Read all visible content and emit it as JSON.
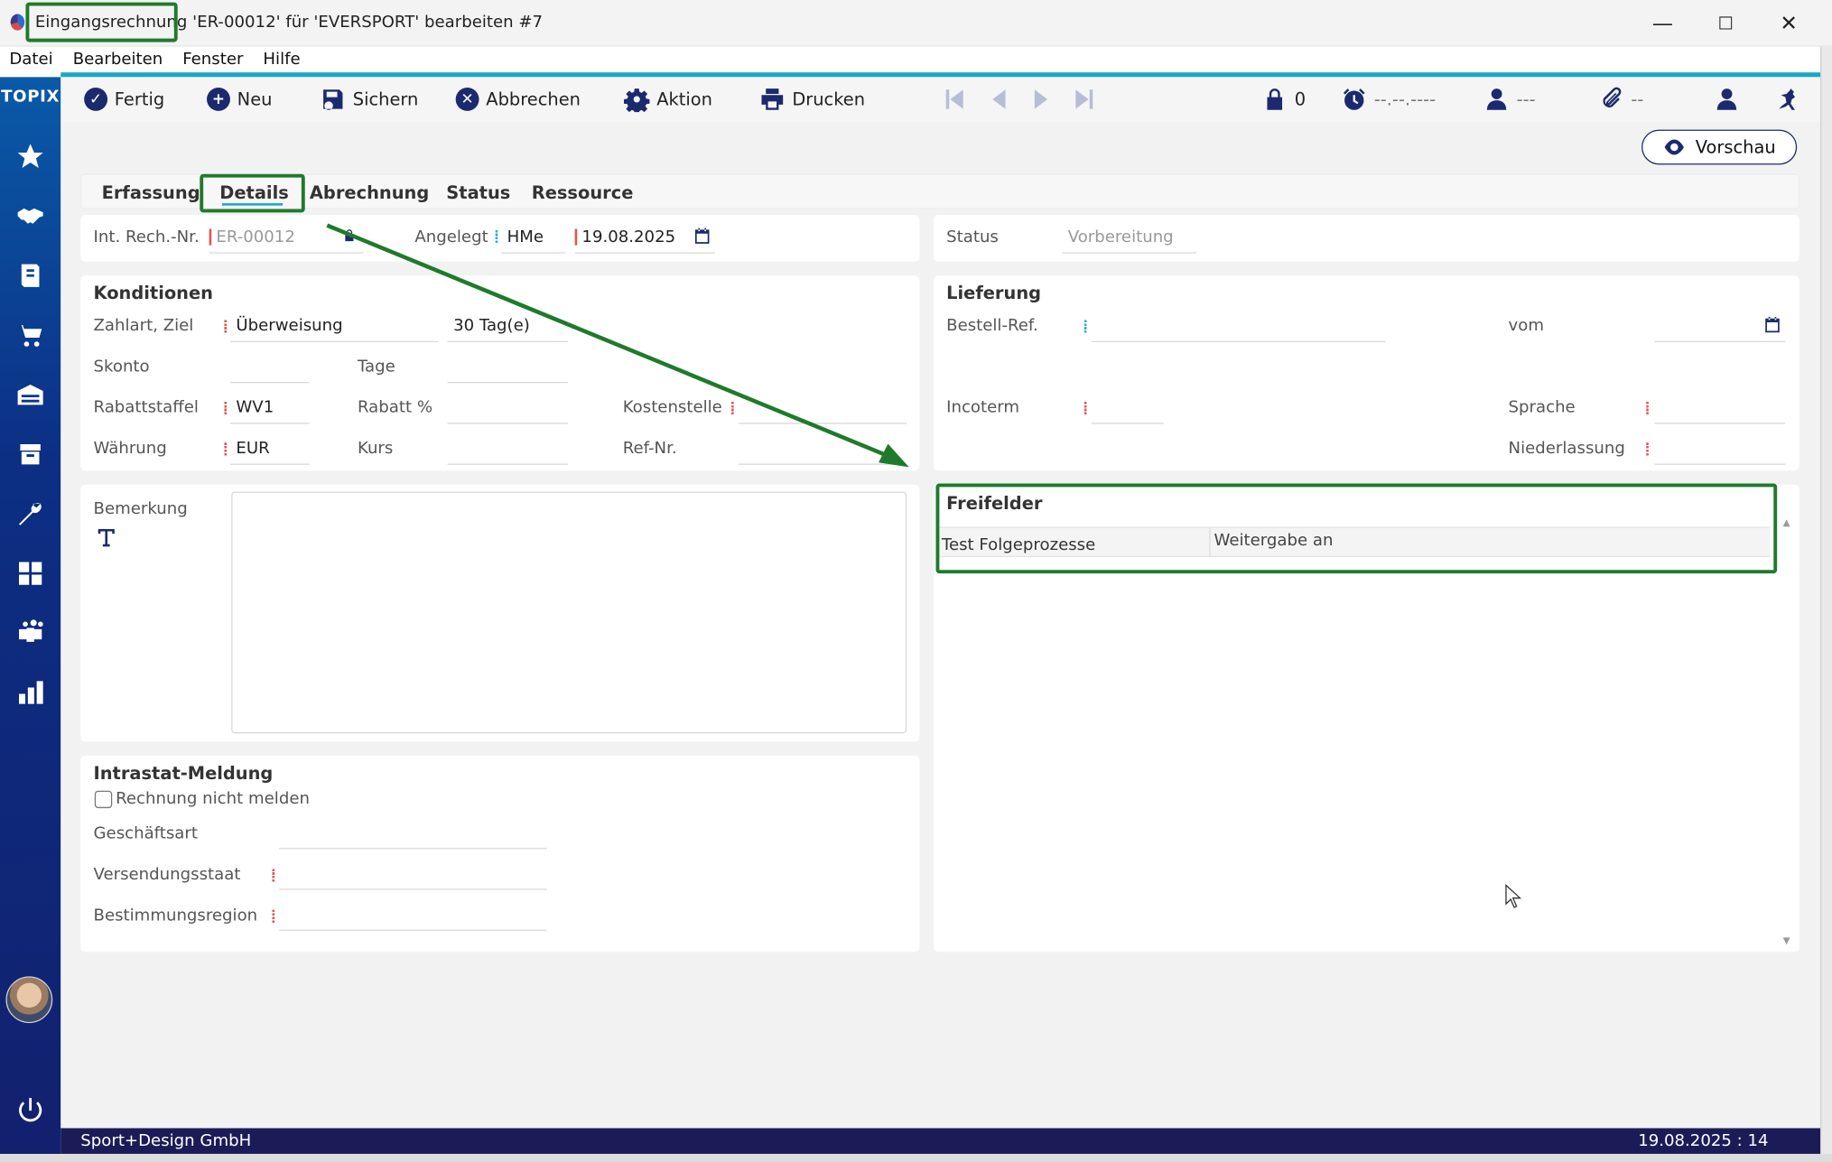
{
  "window": {
    "title": "Eingangsrechnung 'ER-00012' für 'EVERSPORT' bearbeiten #7",
    "minimize": "—",
    "maximize": "☐",
    "close": "✕"
  },
  "menu": [
    "Datei",
    "Bearbeiten",
    "Fenster",
    "Hilfe"
  ],
  "sidebar": {
    "logo": "TOPIX",
    "icons": [
      "star-icon",
      "handshake-icon",
      "invoice-icon",
      "cart-icon",
      "warehouse-icon",
      "archive-icon",
      "wrench-icon",
      "calculator-icon",
      "people-icon",
      "chart-icon",
      "power-icon"
    ]
  },
  "toolbar": {
    "fertig": "Fertig",
    "neu": "Neu",
    "sichern": "Sichern",
    "abbrechen": "Abbrechen",
    "aktion": "Aktion",
    "drucken": "Drucken",
    "lock_count": "0",
    "alarm_value": "--.--.----",
    "user_value": "---",
    "attach_value": "--"
  },
  "vorschau": "Vorschau",
  "tabs": [
    "Erfassung",
    "Details",
    "Abrechnung",
    "Status",
    "Ressource"
  ],
  "active_tab": "Details",
  "header": {
    "int_rech_label": "Int. Rech.-Nr.",
    "int_rech_value": "ER-00012",
    "angelegt_label": "Angelegt",
    "angelegt_user": "HMe",
    "angelegt_date": "19.08.2025",
    "status_label": "Status",
    "status_value": "Vorbereitung"
  },
  "konditionen": {
    "title": "Konditionen",
    "zahlart_label": "Zahlart, Ziel",
    "zahlart_value": "Überweisung",
    "ziel_value": "30 Tag(e)",
    "skonto_label": "Skonto",
    "tage_label": "Tage",
    "rabattstaffel_label": "Rabattstaffel",
    "rabattstaffel_value": "WV1",
    "rabatt_label": "Rabatt %",
    "kostenstelle_label": "Kostenstelle",
    "waehrung_label": "Währung",
    "waehrung_value": "EUR",
    "kurs_label": "Kurs",
    "refnr_label": "Ref-Nr."
  },
  "lieferung": {
    "title": "Lieferung",
    "bestell_label": "Bestell-Ref.",
    "vom_label": "vom",
    "incoterm_label": "Incoterm",
    "sprache_label": "Sprache",
    "niederlassung_label": "Niederlassung"
  },
  "bemerkung": {
    "label": "Bemerkung"
  },
  "freifelder": {
    "title": "Freifelder",
    "field_label": "Test Folgeprozesse",
    "field_value": "Weitergabe an"
  },
  "intrastat": {
    "title": "Intrastat-Meldung",
    "checkbox_label": "Rechnung nicht melden",
    "geschaeftsart_label": "Geschäftsart",
    "versendungsstaat_label": "Versendungsstaat",
    "bestimmungsregion_label": "Bestimmungsregion"
  },
  "statusbar": {
    "company": "Sport+Design GmbH",
    "date": "19.08.2025 : 14"
  },
  "colors": {
    "accent": "#1aa7c9",
    "navy": "#1b2a6e",
    "annotation": "#1f7a2c",
    "required": "#e05454"
  }
}
